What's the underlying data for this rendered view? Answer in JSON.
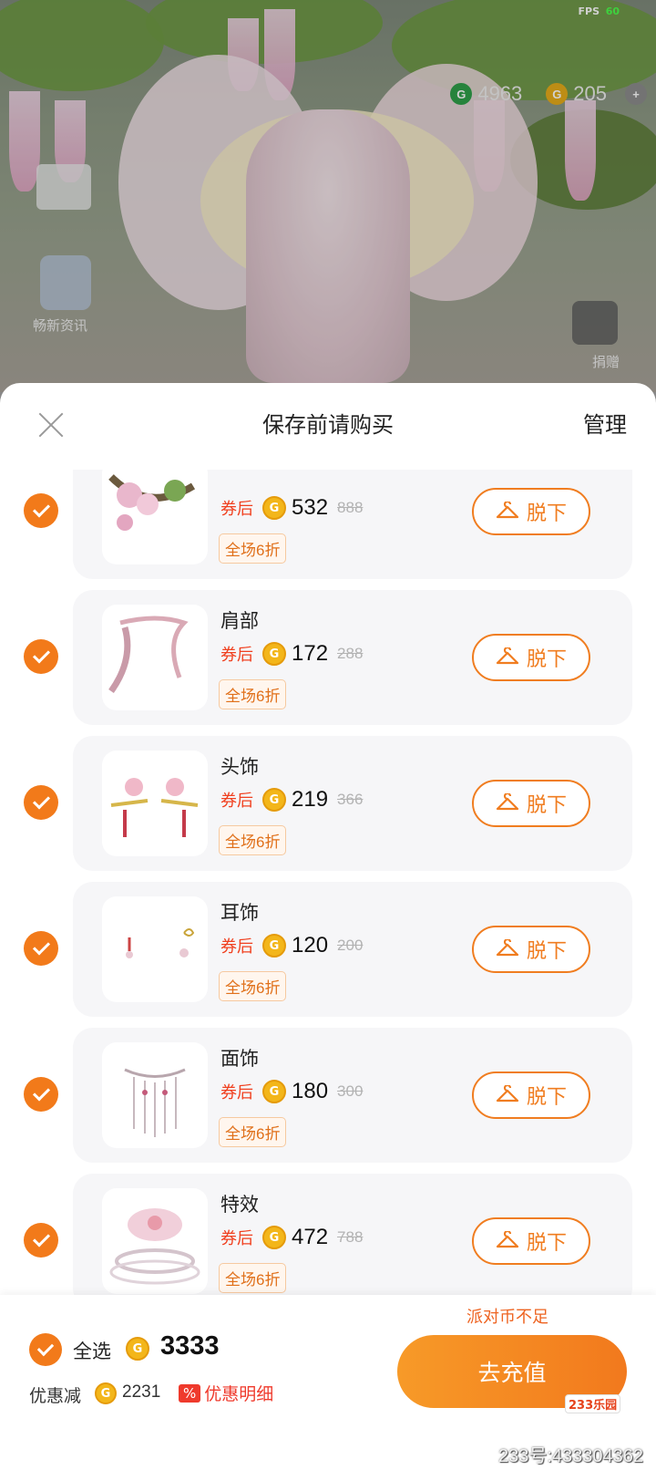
{
  "status": {
    "fps_label": "FPS",
    "fps_value": "60"
  },
  "game_hud": {
    "green_coins": "4963",
    "gold_coins": "205",
    "left_label": "畅新资讯",
    "right_label": "捐赠"
  },
  "sheet": {
    "title": "保存前请购买",
    "manage_label": "管理"
  },
  "items": [
    {
      "name": "",
      "after_label": "券后",
      "price": "532",
      "original": "888",
      "discount": "全场6折",
      "button": "脱下"
    },
    {
      "name": "肩部",
      "after_label": "券后",
      "price": "172",
      "original": "288",
      "discount": "全场6折",
      "button": "脱下"
    },
    {
      "name": "头饰",
      "after_label": "券后",
      "price": "219",
      "original": "366",
      "discount": "全场6折",
      "button": "脱下"
    },
    {
      "name": "耳饰",
      "after_label": "券后",
      "price": "120",
      "original": "200",
      "discount": "全场6折",
      "button": "脱下"
    },
    {
      "name": "面饰",
      "after_label": "券后",
      "price": "180",
      "original": "300",
      "discount": "全场6折",
      "button": "脱下"
    },
    {
      "name": "特效",
      "after_label": "券后",
      "price": "472",
      "original": "788",
      "discount": "全场6折",
      "button": "脱下"
    }
  ],
  "footer": {
    "insufficient": "派对币不足",
    "select_all": "全选",
    "total": "3333",
    "discount_label": "优惠减",
    "discount_amount": "2231",
    "percent_badge": "%",
    "detail_label": "优惠明细",
    "recharge_label": "去充值",
    "watermark": "233号:433304362",
    "watermark_logo": "233乐园"
  },
  "colors": {
    "accent": "#f27a1a",
    "discount_red": "#ef3a2c",
    "coin": "#f3b61a"
  }
}
